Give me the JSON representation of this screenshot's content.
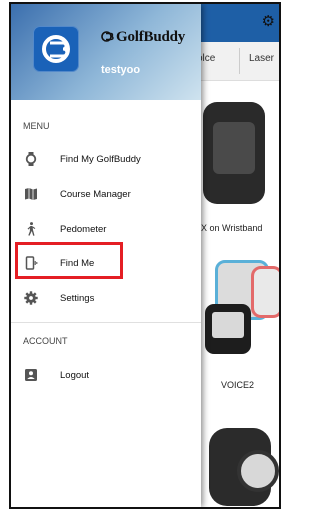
{
  "background_app": {
    "tabs": [
      "olce",
      "Laser"
    ],
    "products": [
      {
        "label": "X on Wristband"
      },
      {
        "label": ""
      },
      {
        "label": "VOICE2"
      },
      {
        "label": ""
      }
    ]
  },
  "drawer": {
    "brand": "GolfBuddy",
    "username": "testyoo",
    "menu_section": "MENU",
    "menu": [
      {
        "label": "Find My GolfBuddy",
        "icon": "watch-icon"
      },
      {
        "label": "Course Manager",
        "icon": "map-icon"
      },
      {
        "label": "Pedometer",
        "icon": "walking-person-icon"
      },
      {
        "label": "Find Me",
        "icon": "vibrating-device-icon"
      },
      {
        "label": "Settings",
        "icon": "gear-icon"
      }
    ],
    "account_section": "ACCOUNT",
    "account": [
      {
        "label": "Logout",
        "icon": "account-box-icon"
      }
    ]
  },
  "highlight_color": "#e41e24",
  "header_accent": "#1a62b8"
}
